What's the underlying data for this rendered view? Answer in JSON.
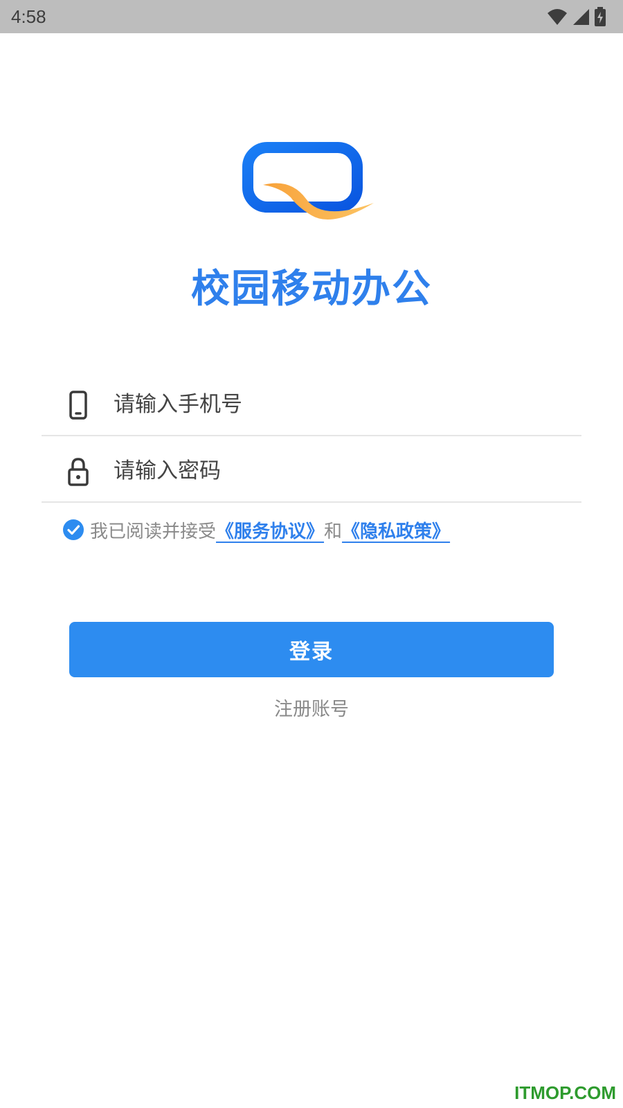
{
  "status_bar": {
    "time": "4:58",
    "icons": [
      "wifi-icon",
      "signal-icon",
      "battery-charging-icon"
    ]
  },
  "app": {
    "title": "校园移动办公",
    "logo": "app-logo",
    "brand_color": "#2f80ec",
    "accent_color": "#f8b84e"
  },
  "form": {
    "phone_placeholder": "请输入手机号",
    "phone_icon": "phone-icon",
    "password_placeholder": "请输入密码",
    "password_icon": "lock-icon"
  },
  "agreement": {
    "checked": true,
    "prefix": "我已阅读并接受",
    "service_link": "《服务协议》",
    "conjunction": "和",
    "privacy_link": "《隐私政策》"
  },
  "actions": {
    "login_label": "登录",
    "register_label": "注册账号"
  },
  "watermark": "ITMOP.COM"
}
